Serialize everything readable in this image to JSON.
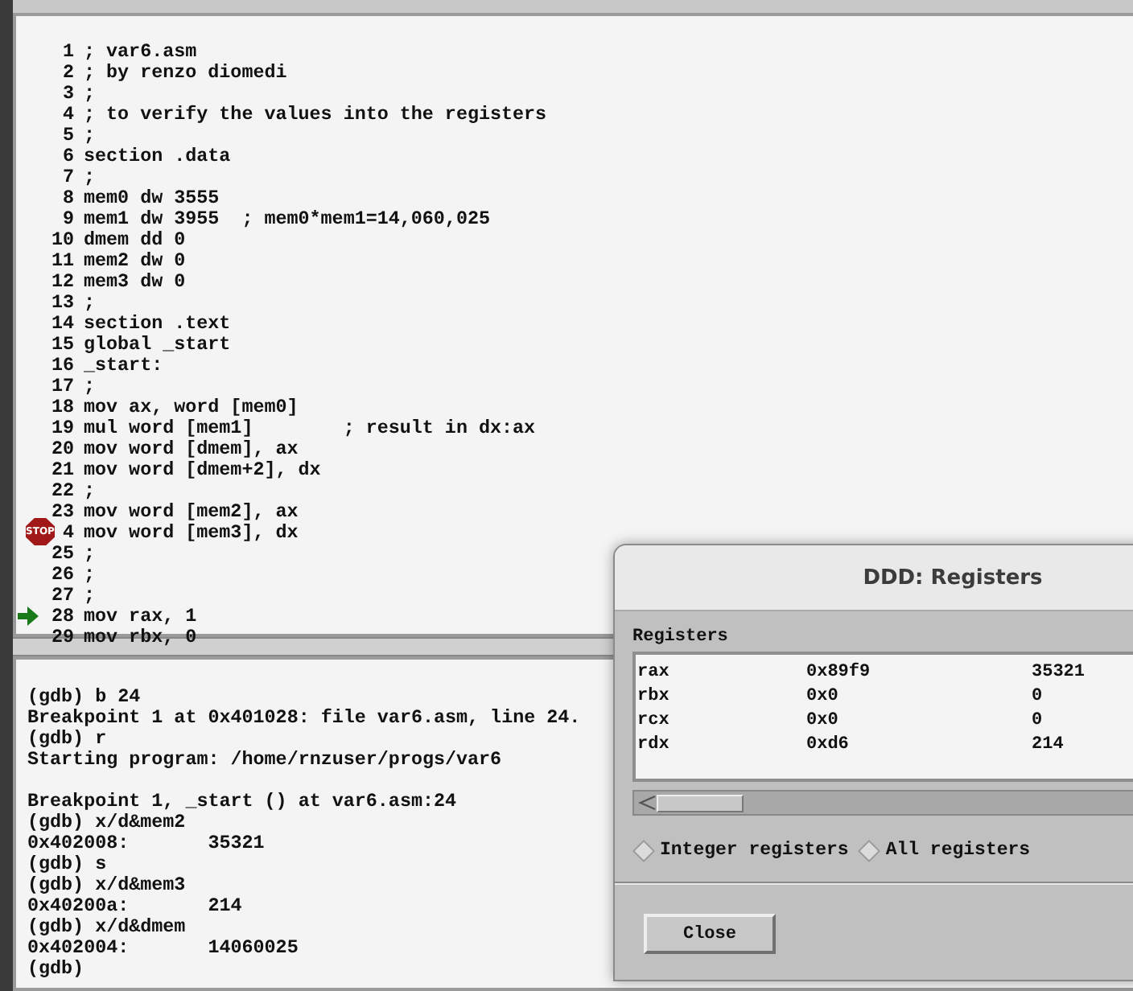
{
  "source": {
    "lines": [
      {
        "number": "1",
        "text": "; var6.asm"
      },
      {
        "number": "2",
        "text": "; by renzo diomedi"
      },
      {
        "number": "3",
        "text": ";"
      },
      {
        "number": "4",
        "text": "; to verify the values into the registers"
      },
      {
        "number": "5",
        "text": ";"
      },
      {
        "number": "6",
        "text": "section .data"
      },
      {
        "number": "7",
        "text": ";"
      },
      {
        "number": "8",
        "text": "mem0 dw 3555"
      },
      {
        "number": "9",
        "text": "mem1 dw 3955  ; mem0*mem1=14,060,025"
      },
      {
        "number": "10",
        "text": "dmem dd 0"
      },
      {
        "number": "11",
        "text": "mem2 dw 0"
      },
      {
        "number": "12",
        "text": "mem3 dw 0"
      },
      {
        "number": "13",
        "text": ";"
      },
      {
        "number": "14",
        "text": "section .text"
      },
      {
        "number": "15",
        "text": "global _start"
      },
      {
        "number": "16",
        "text": "_start:"
      },
      {
        "number": "17",
        "text": ";"
      },
      {
        "number": "18",
        "text": "mov ax, word [mem0]"
      },
      {
        "number": "19",
        "text": "mul word [mem1]        ; result in dx:ax"
      },
      {
        "number": "20",
        "text": "mov word [dmem], ax"
      },
      {
        "number": "21",
        "text": "mov word [dmem+2], dx"
      },
      {
        "number": "22",
        "text": ";"
      },
      {
        "number": "23",
        "text": "mov word [mem2], ax"
      },
      {
        "number": "4",
        "text": "mov word [mem3], dx",
        "kind": "breakpoint",
        "marker_label": "STOP"
      },
      {
        "number": "25",
        "text": ";"
      },
      {
        "number": "26",
        "text": ";"
      },
      {
        "number": "27",
        "text": ";"
      },
      {
        "number": "28",
        "text": "mov rax, 1",
        "kind": "pc"
      },
      {
        "number": "29",
        "text": "mov rbx, 0"
      }
    ]
  },
  "console": {
    "blocks": [
      [
        "(gdb) b 24",
        "Breakpoint 1 at 0x401028: file var6.asm, line 24.",
        "(gdb) r",
        "Starting program: /home/rnzuser/progs/var6"
      ],
      [
        "Breakpoint 1, _start () at var6.asm:24",
        "(gdb) x/d&mem2",
        "0x402008:       35321",
        "(gdb) s",
        "(gdb) x/d&mem3",
        "0x40200a:       214",
        "(gdb) x/d&dmem",
        "0x402004:       14060025",
        "(gdb)"
      ]
    ]
  },
  "dialog": {
    "title": "DDD: Registers",
    "section_label": "Registers",
    "registers": [
      {
        "name": "rax",
        "hex": "0x89f9",
        "value": "35321"
      },
      {
        "name": "rbx",
        "hex": "0x0",
        "value": "0"
      },
      {
        "name": "rcx",
        "hex": "0x0",
        "value": "0"
      },
      {
        "name": "rdx",
        "hex": "0xd6",
        "value": "214"
      }
    ],
    "options": [
      {
        "label": "Integer registers",
        "selected": false
      },
      {
        "label": "All registers",
        "selected": false
      }
    ],
    "buttons": [
      "Close"
    ]
  }
}
